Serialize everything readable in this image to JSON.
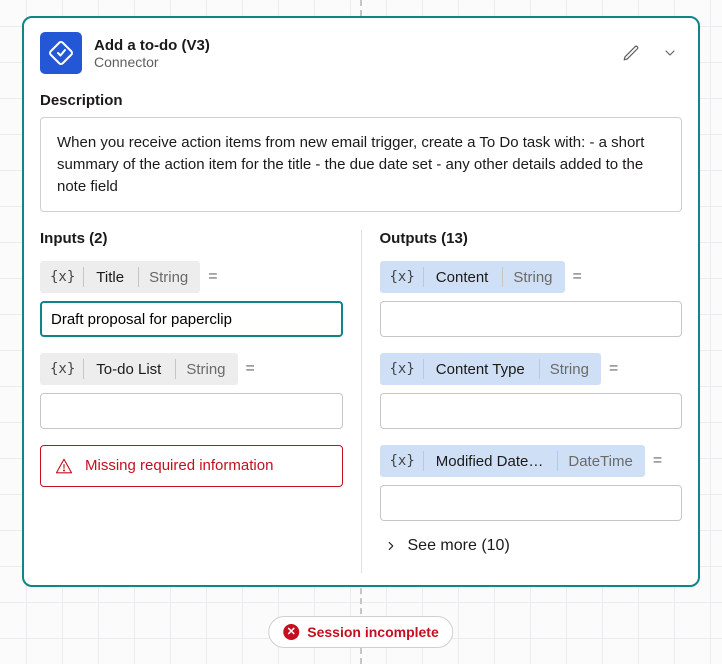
{
  "header": {
    "title": "Add a to-do (V3)",
    "subtitle": "Connector"
  },
  "description_label": "Description",
  "description": "When you receive action items from new email trigger, create a To Do task with: - a short summary of the action item for the title - the due date set - any other details added to the note field",
  "inputs": {
    "heading": "Inputs (2)",
    "fx": "{x}",
    "equals": "=",
    "fields": [
      {
        "name": "Title",
        "type": "String",
        "value": "Draft proposal for paperclip",
        "focused": true
      },
      {
        "name": "To-do List",
        "type": "String",
        "value": "",
        "focused": false
      }
    ],
    "error": "Missing required information"
  },
  "outputs": {
    "heading": "Outputs (13)",
    "fx": "{x}",
    "equals": "=",
    "fields": [
      {
        "name": "Content",
        "type": "String",
        "value": ""
      },
      {
        "name": "Content Type",
        "type": "String",
        "value": ""
      },
      {
        "name": "Modified Date…",
        "type": "DateTime",
        "value": ""
      }
    ],
    "see_more": "See more (10)"
  },
  "status": "Session incomplete"
}
